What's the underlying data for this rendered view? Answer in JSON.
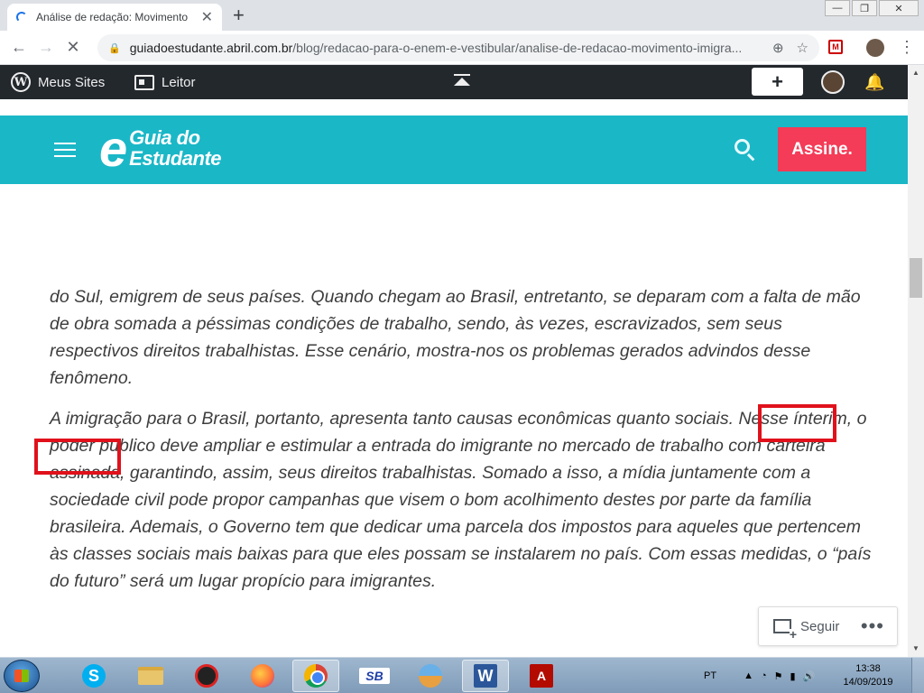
{
  "browser": {
    "tab_title": "Análise de redação: Movimento i",
    "new_tab_label": "+",
    "tab_close_glyph": "✕",
    "url_host": "guiadoestudante.abril.com.br",
    "url_path": "/blog/redacao-para-o-enem-e-vestibular/analise-de-redacao-movimento-imigra...",
    "window_controls": {
      "minimize": "—",
      "maximize": "❐",
      "close": "✕"
    },
    "nav": {
      "back": "←",
      "forward": "→",
      "reload": "✕"
    },
    "omni_icons": {
      "zoom": "⊕",
      "star": "☆"
    },
    "ext_label": "M",
    "menu_glyph": "⋮"
  },
  "wp_admin_bar": {
    "logo": "W",
    "my_sites_label": "Meus Sites",
    "reader_label": "Leitor",
    "write_glyph": "+",
    "bell_glyph": "🔔"
  },
  "site_header": {
    "logo_e": "e",
    "logo_line1": "Guia do",
    "logo_line2": "Estudante",
    "subscribe_label": "Assine."
  },
  "article": {
    "paragraph_1": "do Sul, emigrem de seus países. Quando chegam ao Brasil, entretanto, se deparam com a falta de mão de obra somada a péssimas condições de trabalho, sendo, às vezes, escravizados, sem seus respectivos direitos trabalhistas. Esse cenário, mostra-nos os problemas gerados advindos desse fenômeno.",
    "paragraph_2": "A imigração para o Brasil, portanto, apresenta tanto causas econômicas quanto sociais. Nesse ínterim, o poder público deve ampliar e estimular a entrada do imigrante no mercado de trabalho com carteira assinada, garantindo, assim, seus direitos trabalhistas. Somado a isso, a mídia juntamente com a sociedade civil pode propor campanhas que visem o bom acolhimento destes por parte da família brasileira. Ademais, o Governo tem que dedicar uma parcela dos impostos para aqueles que pertencem às classes sociais mais baixas para que eles possam se instalarem no país. Com essas medidas, o “país do futuro” será um lugar propício para imigrantes."
  },
  "follow_widget": {
    "label": "Seguir",
    "more": "•••"
  },
  "taskbar": {
    "skype": "S",
    "sb": "SB",
    "word": "W",
    "pdf": "A",
    "language": "PT",
    "tray_arrow": "▲",
    "time": "13:38",
    "date": "14/09/2019"
  },
  "scrollbar": {
    "up": "▲",
    "down": "▼"
  },
  "colors": {
    "header_teal": "#1ab7c7",
    "subscribe_red": "#f43b57",
    "wp_bar": "#23282d",
    "highlight_red": "#e0111b"
  }
}
